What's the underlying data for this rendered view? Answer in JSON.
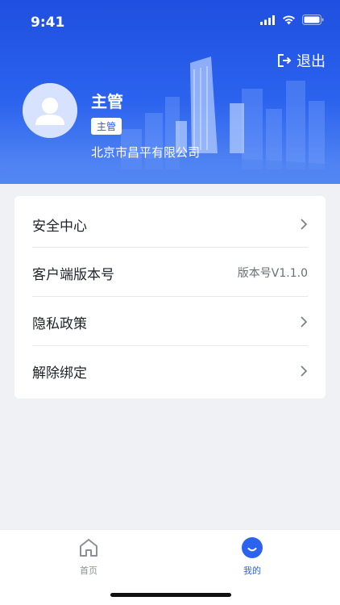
{
  "status_bar": {
    "time": "9:41"
  },
  "header": {
    "logout_label": "退出",
    "user_name": "主管",
    "role_tag": "主管",
    "company": "北京市昌平有限公司"
  },
  "menu": {
    "items": [
      {
        "label": "安全中心"
      },
      {
        "label": "客户端版本号",
        "value": "版本号V1.1.0"
      },
      {
        "label": "隐私政策"
      },
      {
        "label": "解除绑定"
      }
    ]
  },
  "tabbar": {
    "tabs": [
      {
        "label": "首页",
        "active": false
      },
      {
        "label": "我的",
        "active": true
      }
    ]
  },
  "colors": {
    "brand_blue": "#2b63ee",
    "header_top": "#1f4fe0",
    "page_bg": "#f0f1f4",
    "text_primary": "#1f2329",
    "text_secondary": "#6b6f76",
    "tab_active": "#2b63ee",
    "tab_inactive": "#8c9096"
  },
  "icons": {
    "logout": "logout-icon",
    "avatar": "user-avatar-icon",
    "chevron": "chevron-right-icon",
    "home": "home-icon",
    "mine": "profile-icon",
    "signal": "signal-icon",
    "wifi": "wifi-icon",
    "battery": "battery-icon"
  }
}
